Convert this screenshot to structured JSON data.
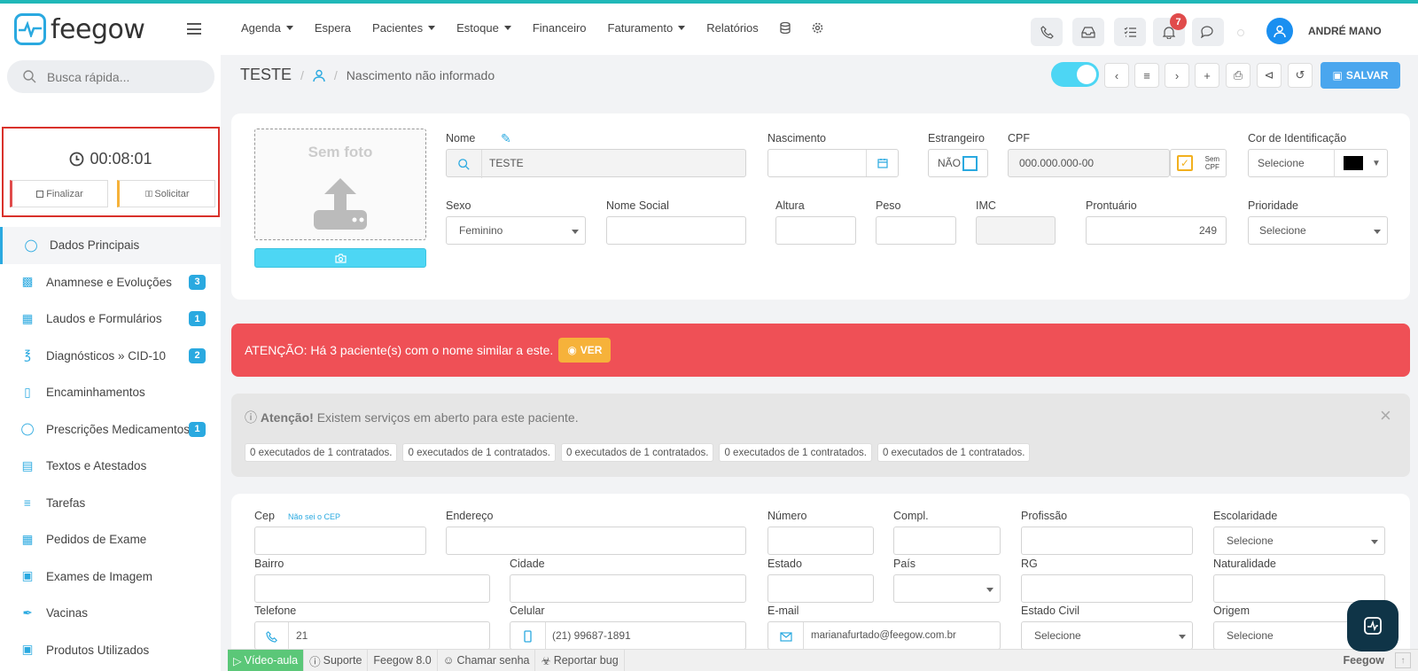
{
  "app": {
    "logo_text": "feegow",
    "brand_color": "#2aa9e0",
    "accent_teal": "#20b8b8"
  },
  "nav": {
    "items": [
      {
        "label": "Agenda",
        "dropdown": true
      },
      {
        "label": "Espera",
        "dropdown": false
      },
      {
        "label": "Pacientes",
        "dropdown": true
      },
      {
        "label": "Estoque",
        "dropdown": true
      },
      {
        "label": "Financeiro",
        "dropdown": false
      },
      {
        "label": "Faturamento",
        "dropdown": true
      },
      {
        "label": "Relatórios",
        "dropdown": false
      }
    ]
  },
  "topbar": {
    "notifications_count": "7",
    "user_name": "ANDRÉ MANO"
  },
  "sidebar": {
    "search_placeholder": "Busca rápida...",
    "timer": "00:08:01",
    "finalizar": "Finalizar",
    "solicitar": "Solicitar",
    "items": [
      {
        "label": "Dados Principais",
        "icon": "user-icon",
        "count": ""
      },
      {
        "label": "Anamnese e Evoluções",
        "icon": "chart-icon",
        "count": "3"
      },
      {
        "label": "Laudos e Formulários",
        "icon": "clipboard-icon",
        "count": "1"
      },
      {
        "label": "Diagnósticos » CID-10",
        "icon": "stethoscope-icon",
        "count": "2"
      },
      {
        "label": "Encaminhamentos",
        "icon": "document-icon",
        "count": ""
      },
      {
        "label": "Prescrições Medicamentos",
        "icon": "pills-icon",
        "count": "1"
      },
      {
        "label": "Textos e Atestados",
        "icon": "text-file-icon",
        "count": ""
      },
      {
        "label": "Tarefas",
        "icon": "tasks-icon",
        "count": ""
      },
      {
        "label": "Pedidos de Exame",
        "icon": "building-icon",
        "count": ""
      },
      {
        "label": "Exames de Imagem",
        "icon": "image-icon",
        "count": ""
      },
      {
        "label": "Vacinas",
        "icon": "syringe-icon",
        "count": ""
      },
      {
        "label": "Produtos Utilizados",
        "icon": "box-icon",
        "count": ""
      }
    ]
  },
  "header": {
    "patient_name": "TESTE",
    "birth_info": "Nascimento não informado",
    "save_label": "SALVAR"
  },
  "form": {
    "photo_label": "Sem foto",
    "nome_label": "Nome",
    "nome_value": "TESTE",
    "nascimento_label": "Nascimento",
    "nascimento_value": "",
    "estrangeiro_label": "Estrangeiro",
    "estrangeiro_value": "NÃO",
    "cpf_label": "CPF",
    "cpf_placeholder": "000.000.000-00",
    "sem_cpf_line1": "Sem",
    "sem_cpf_line2": "CPF",
    "cor_label": "Cor de Identificação",
    "cor_value": "Selecione",
    "sexo_label": "Sexo",
    "sexo_value": "Feminino",
    "nome_social_label": "Nome Social",
    "altura_label": "Altura",
    "peso_label": "Peso",
    "imc_label": "IMC",
    "prontuario_label": "Prontuário",
    "prontuario_value": "249",
    "prioridade_label": "Prioridade",
    "prioridade_value": "Selecione"
  },
  "alert": {
    "text": "ATENÇÃO: Há 3 paciente(s) com o nome similar a este.",
    "button": "VER"
  },
  "services": {
    "bold": "Atenção!",
    "text": "Existem serviços em aberto para este paciente.",
    "chips": [
      "0 executados de 1 contratados.",
      "0 executados de 1 contratados.",
      "0 executados de 1 contratados.",
      "0 executados de 1 contratados.",
      "0 executados de 1 contratados."
    ]
  },
  "address": {
    "cep_label": "Cep",
    "cep_help": "Não sei o CEP",
    "endereco_label": "Endereço",
    "numero_label": "Número",
    "compl_label": "Compl.",
    "profissao_label": "Profissão",
    "escolaridade_label": "Escolaridade",
    "escolaridade_value": "Selecione",
    "bairro_label": "Bairro",
    "cidade_label": "Cidade",
    "estado_label": "Estado",
    "pais_label": "País",
    "rg_label": "RG",
    "naturalidade_label": "Naturalidade",
    "telefone_label": "Telefone",
    "telefone_value": "21",
    "celular_label": "Celular",
    "celular_value": "(21) 99687-1891",
    "email_label": "E-mail",
    "email_value": "marianafurtado@feegow.com.br",
    "estado_civil_label": "Estado Civil",
    "estado_civil_value": "Selecione",
    "origem_label": "Origem",
    "origem_value": "Selecione"
  },
  "footer": {
    "video": "Vídeo-aula",
    "suporte": "Suporte",
    "version": "Feegow 8.0",
    "chamar": "Chamar senha",
    "bug": "Reportar bug",
    "brand": "Feegow"
  }
}
